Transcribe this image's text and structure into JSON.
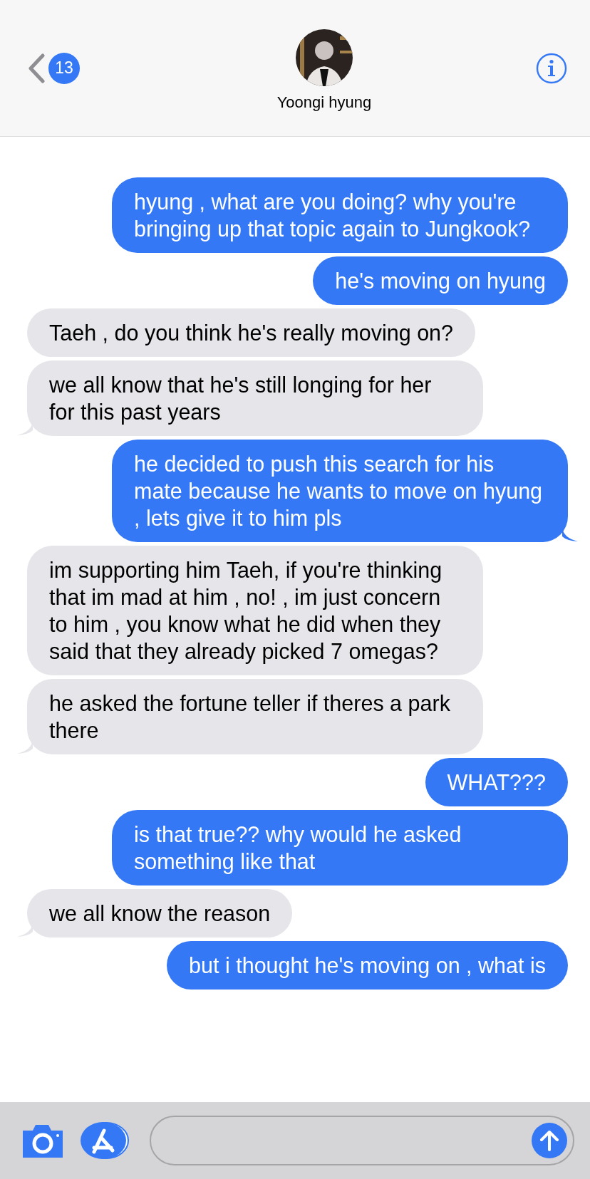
{
  "header": {
    "back_badge": "13",
    "contact_name": "Yoongi hyung"
  },
  "messages": [
    {
      "kind": "sent",
      "text": "hyung , what are you doing? why you're bringing up that topic again to Jungkook?",
      "tail": false
    },
    {
      "kind": "sent",
      "text": "he's moving on hyung",
      "tail": false
    },
    {
      "kind": "received",
      "text": "Taeh , do you think he's really moving on?",
      "tail": false
    },
    {
      "kind": "received",
      "text": "we all know that he's still longing for her for this past years",
      "tail": true
    },
    {
      "kind": "sent",
      "text": "he decided to push this search for his mate because he wants to move on hyung , lets give it to him  pls",
      "tail": true
    },
    {
      "kind": "received",
      "text": "im supporting him Taeh, if you're thinking that im mad at him , no! ,  im just concern to him , you know what he did when they said that they already picked 7 omegas?",
      "tail": false
    },
    {
      "kind": "received",
      "text": "he asked the fortune teller if theres a park there",
      "tail": true
    },
    {
      "kind": "sent",
      "text": "WHAT???",
      "tail": false
    },
    {
      "kind": "sent",
      "text": "is that true?? why would he asked something like that",
      "tail": false
    },
    {
      "kind": "received",
      "text": "we all know the reason",
      "tail": true
    },
    {
      "kind": "sent",
      "text": "but i thought he's moving on , what is",
      "tail": false
    }
  ],
  "composer": {
    "send_enabled": true
  }
}
